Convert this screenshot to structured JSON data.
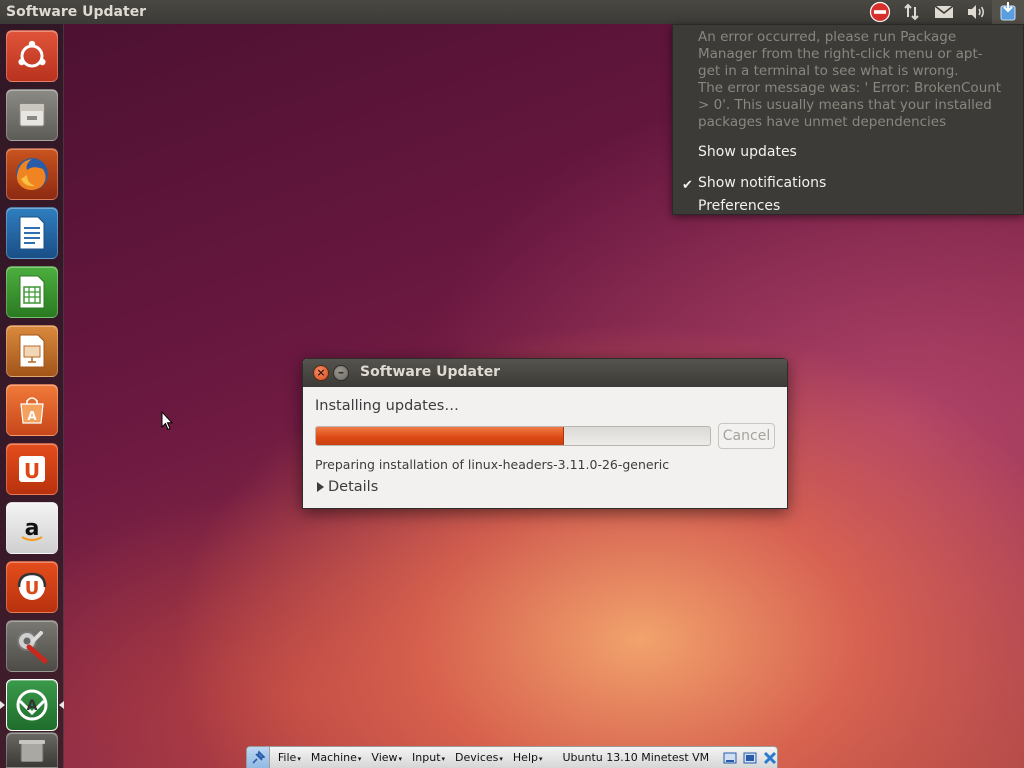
{
  "top_panel": {
    "title": "Software Updater",
    "indicators": [
      "software-updater-error-icon",
      "network-icon",
      "mail-icon",
      "volume-icon",
      "update-indicator-icon"
    ]
  },
  "indicator_menu": {
    "error_lines": [
      "An error occurred, please run Package",
      "Manager from the right-click menu or apt-",
      "get in a terminal to see what is wrong.",
      "The error message was: ' Error: BrokenCount",
      "> 0'. This usually means that your installed",
      "packages have unmet dependencies"
    ],
    "show_updates": "Show updates",
    "show_notifications": "Show notifications",
    "show_notifications_checked": true,
    "preferences": "Preferences"
  },
  "launcher": {
    "items": [
      "ubuntu-dash-icon",
      "files-icon",
      "firefox-icon",
      "libreoffice-writer-icon",
      "libreoffice-calc-icon",
      "libreoffice-impress-icon",
      "software-center-icon",
      "ubuntu-one-icon",
      "amazon-icon",
      "ubuntu-one-music-icon",
      "system-settings-icon",
      "software-updater-icon",
      "trash-icon"
    ]
  },
  "dialog": {
    "title": "Software Updater",
    "heading": "Installing updates…",
    "progress": 0.63,
    "cancel_label": "Cancel",
    "cancel_enabled": false,
    "status": "Preparing installation of linux-headers-3.11.0-26-generic",
    "details_label": "Details"
  },
  "vbox_toolbar": {
    "menus": [
      "File",
      "Machine",
      "View",
      "Input",
      "Devices",
      "Help"
    ],
    "vm_title": "Ubuntu 13.10 Minetest VM"
  },
  "colors": {
    "accent": "#dd4814",
    "panel": "#3c3b37"
  }
}
